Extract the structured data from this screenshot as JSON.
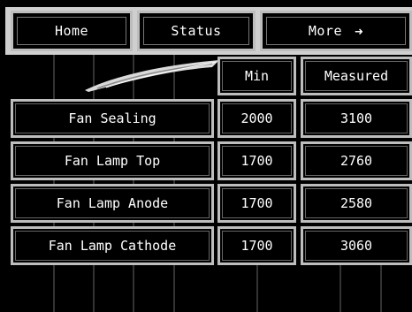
{
  "nav": {
    "home": "Home",
    "status": "Status",
    "more": "More",
    "more_arrow": "➜"
  },
  "table": {
    "headers": {
      "min": "Min",
      "measured": "Measured"
    },
    "rows": [
      {
        "label": "Fan Sealing",
        "min": "2000",
        "measured": "3100"
      },
      {
        "label": "Fan Lamp Top",
        "min": "1700",
        "measured": "2760"
      },
      {
        "label": "Fan Lamp Anode",
        "min": "1700",
        "measured": "2580"
      },
      {
        "label": "Fan Lamp Cathode",
        "min": "1700",
        "measured": "3060"
      }
    ]
  },
  "colors": {
    "background": "#000000",
    "border": "#bdbdbd",
    "text": "#ffffff"
  }
}
